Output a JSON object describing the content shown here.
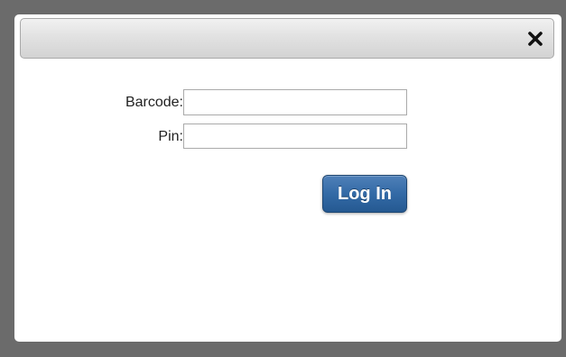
{
  "dialog": {
    "close_icon": "close-x-icon"
  },
  "form": {
    "barcode_label": "Barcode:",
    "barcode_value": "",
    "pin_label": "Pin:",
    "pin_value": "",
    "login_label": "Log In"
  },
  "colors": {
    "backdrop": "#6b6b6b",
    "button": "#336aa6"
  }
}
